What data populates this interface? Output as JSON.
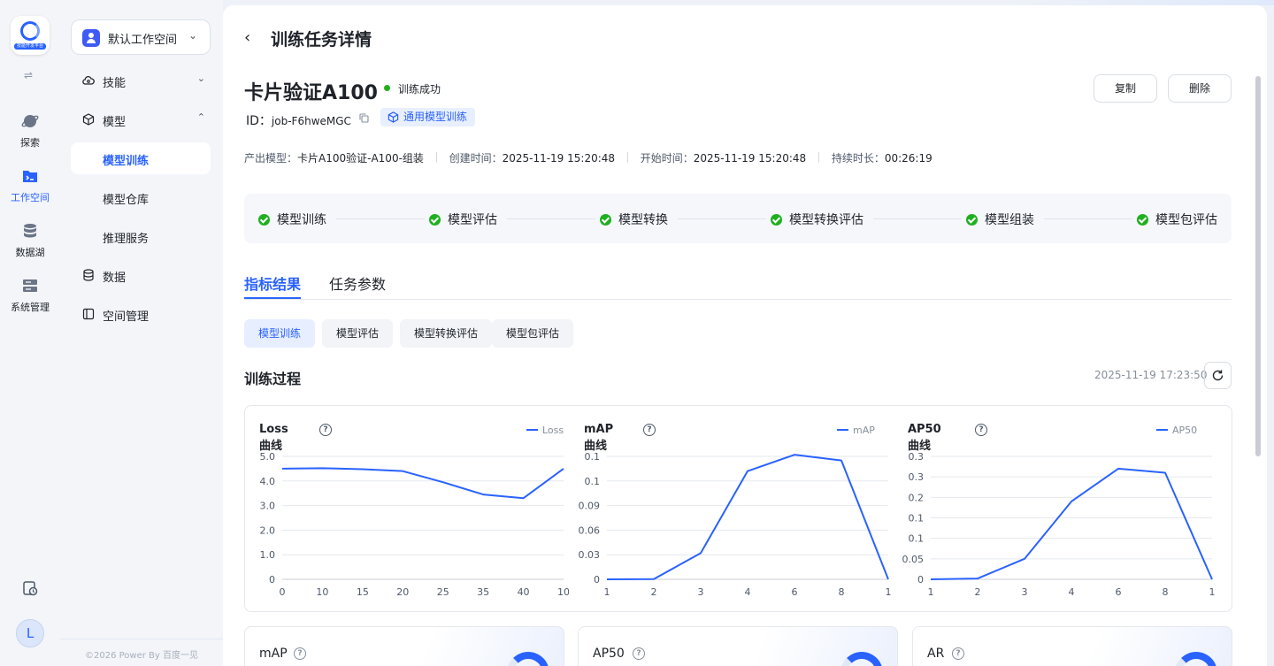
{
  "rail": {
    "logo_caption": "技能开发平台",
    "items": [
      {
        "label": "探索",
        "icon": "planet-icon"
      },
      {
        "label": "工作空间",
        "icon": "terminal-folder-icon"
      },
      {
        "label": "数据湖",
        "icon": "database-icon"
      },
      {
        "label": "系统管理",
        "icon": "server-settings-icon"
      }
    ],
    "avatar_initial": "L"
  },
  "sidebar": {
    "workspace": "默认工作空间",
    "nav": [
      {
        "label": "技能",
        "icon": "skill-cloud-icon",
        "chevron": "⌄"
      },
      {
        "label": "模型",
        "icon": "cube-icon",
        "chevron": "⌃"
      },
      {
        "label": "模型训练",
        "active": true
      },
      {
        "label": "模型仓库"
      },
      {
        "label": "推理服务"
      },
      {
        "label": "数据",
        "icon": "database-icon"
      },
      {
        "label": "空间管理",
        "icon": "space-icon"
      }
    ],
    "copyright": "©2026 Power By 百度一见"
  },
  "header": {
    "page_title": "训练任务详情",
    "task_name": "卡片验证A100",
    "status": "训练成功",
    "status_color": "#1fb01f",
    "copy_label": "复制",
    "delete_label": "删除",
    "id_label": "ID：",
    "job_id": "job-F6hweMGC",
    "type_tag": "通用模型训练"
  },
  "meta": [
    {
      "label": "产出模型：",
      "value": "卡片A100验证-A100-组装"
    },
    {
      "label": "创建时间：",
      "value": "2025-11-19 15:20:48"
    },
    {
      "label": "开始时间：",
      "value": "2025-11-19 15:20:48"
    },
    {
      "label": "持续时长：",
      "value": "00:26:19"
    }
  ],
  "steps": [
    "模型训练",
    "模型评估",
    "模型转换",
    "模型转换评估",
    "模型组装",
    "模型包评估"
  ],
  "tabs": [
    "指标结果",
    "任务参数"
  ],
  "chips": [
    "模型训练",
    "模型评估",
    "模型转换评估",
    "模型包评估"
  ],
  "section": {
    "title": "训练过程",
    "timestamp": "2025-11-19 17:23:50"
  },
  "accent_color": "#2a62ff",
  "chart_data": [
    {
      "type": "line",
      "title": "Loss曲线",
      "series": [
        {
          "name": "Loss",
          "values": [
            4.5,
            4.52,
            4.48,
            4.4,
            3.95,
            3.45,
            3.3,
            4.5
          ]
        }
      ],
      "categories": [
        "0",
        "10",
        "15",
        "20",
        "25",
        "35",
        "40",
        "10"
      ],
      "yticks": [
        "0",
        "1.0",
        "2.0",
        "3.0",
        "4.0",
        "5.0"
      ],
      "ylim": [
        0,
        5
      ],
      "grid": true,
      "legend": "top-right"
    },
    {
      "type": "line",
      "title": "mAP曲线",
      "series": [
        {
          "name": "mAP",
          "values": [
            0,
            0.0003,
            0.032,
            0.132,
            0.152,
            0.145,
            0
          ]
        }
      ],
      "categories": [
        "1",
        "2",
        "3",
        "4",
        "6",
        "8",
        "1"
      ],
      "yticks": [
        "0",
        "0.03",
        "0.06",
        "0.09",
        "0.1",
        "0.1"
      ],
      "ylim": [
        0,
        0.15
      ],
      "grid": true,
      "legend": "top-right"
    },
    {
      "type": "line",
      "title": "AP50曲线",
      "series": [
        {
          "name": "AP50",
          "values": [
            0,
            0.002,
            0.05,
            0.19,
            0.27,
            0.26,
            0
          ]
        }
      ],
      "categories": [
        "1",
        "2",
        "3",
        "4",
        "6",
        "8",
        "1"
      ],
      "yticks": [
        "0",
        "0.05",
        "0.1",
        "0.1",
        "0.2",
        "0.3",
        "0.3"
      ],
      "ylim": [
        0,
        0.3
      ],
      "grid": true,
      "legend": "top-right"
    }
  ],
  "metric_cards": [
    "mAP",
    "AP50",
    "AR"
  ]
}
